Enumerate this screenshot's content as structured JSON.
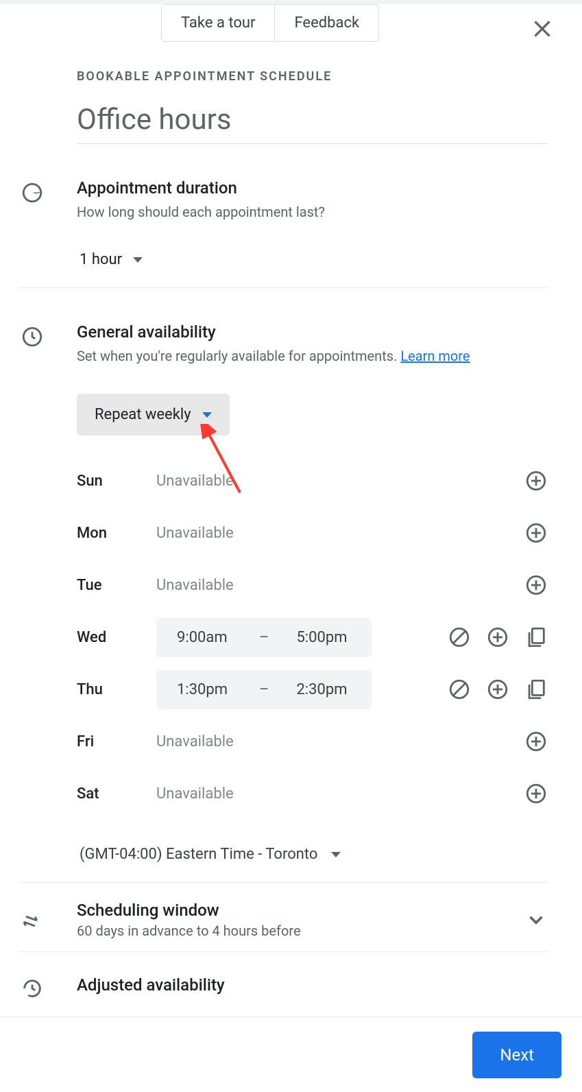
{
  "header": {
    "take_tour": "Take a tour",
    "feedback": "Feedback"
  },
  "breadcrumb": "BOOKABLE APPOINTMENT SCHEDULE",
  "title": "Office hours",
  "duration": {
    "title": "Appointment duration",
    "sub": "How long should each appointment last?",
    "value": "1 hour"
  },
  "availability": {
    "title": "General availability",
    "sub_prefix": "Set when you're regularly available for appointments. ",
    "learn_more": "Learn more",
    "repeat": "Repeat weekly",
    "days": {
      "sun": {
        "label": "Sun",
        "status": "Unavailable"
      },
      "mon": {
        "label": "Mon",
        "status": "Unavailable"
      },
      "tue": {
        "label": "Tue",
        "status": "Unavailable"
      },
      "wed": {
        "label": "Wed",
        "start": "9:00am",
        "end": "5:00pm"
      },
      "thu": {
        "label": "Thu",
        "start": "1:30pm",
        "end": "2:30pm"
      },
      "fri": {
        "label": "Fri",
        "status": "Unavailable"
      },
      "sat": {
        "label": "Sat",
        "status": "Unavailable"
      }
    },
    "separator": "–",
    "timezone": "(GMT-04:00) Eastern Time - Toronto"
  },
  "scheduling_window": {
    "title": "Scheduling window",
    "sub": "60 days in advance to 4 hours before"
  },
  "adjusted": {
    "title": "Adjusted availability"
  },
  "footer": {
    "next": "Next"
  }
}
